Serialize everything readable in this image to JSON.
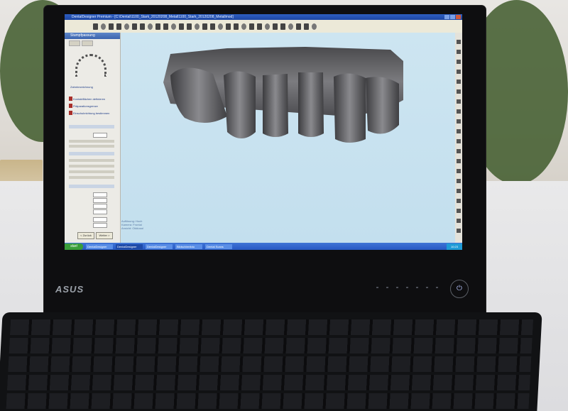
{
  "scene": {
    "monitor_brand": "ASUS",
    "power_symbol": "⏻"
  },
  "app": {
    "window_title": "DentalDesigner Premium - [C:\\Dental\\1100_Stark_20120208_Metall1100_Stark_20120208_Metallmod]",
    "sidebar_title": "Stumpfpassung",
    "sidebar_labels": [
      "Zahnbezeichnung",
      "Kontaktflächen definieren",
      "Präparationsgrenze",
      "Einschubrichtung bestimmen"
    ],
    "sidebar_buttons": [
      "< Zurück",
      "Weiter >"
    ],
    "status_lines": [
      "Auflösung: Hoch",
      "Kamera: Frontal",
      "Ansicht: Okklusal"
    ]
  },
  "taskbar": {
    "start_label": "start",
    "tasks": [
      "DentalDesigner",
      "DentalDesigner",
      "DentalDesigner",
      "Bildschirmfoto",
      "Dental Scans"
    ],
    "tray_time": "10:23"
  },
  "colors": {
    "viewport_bg": "#cfe6f1",
    "teeth": "#6f6f72",
    "bezel": "#0e0e10"
  }
}
